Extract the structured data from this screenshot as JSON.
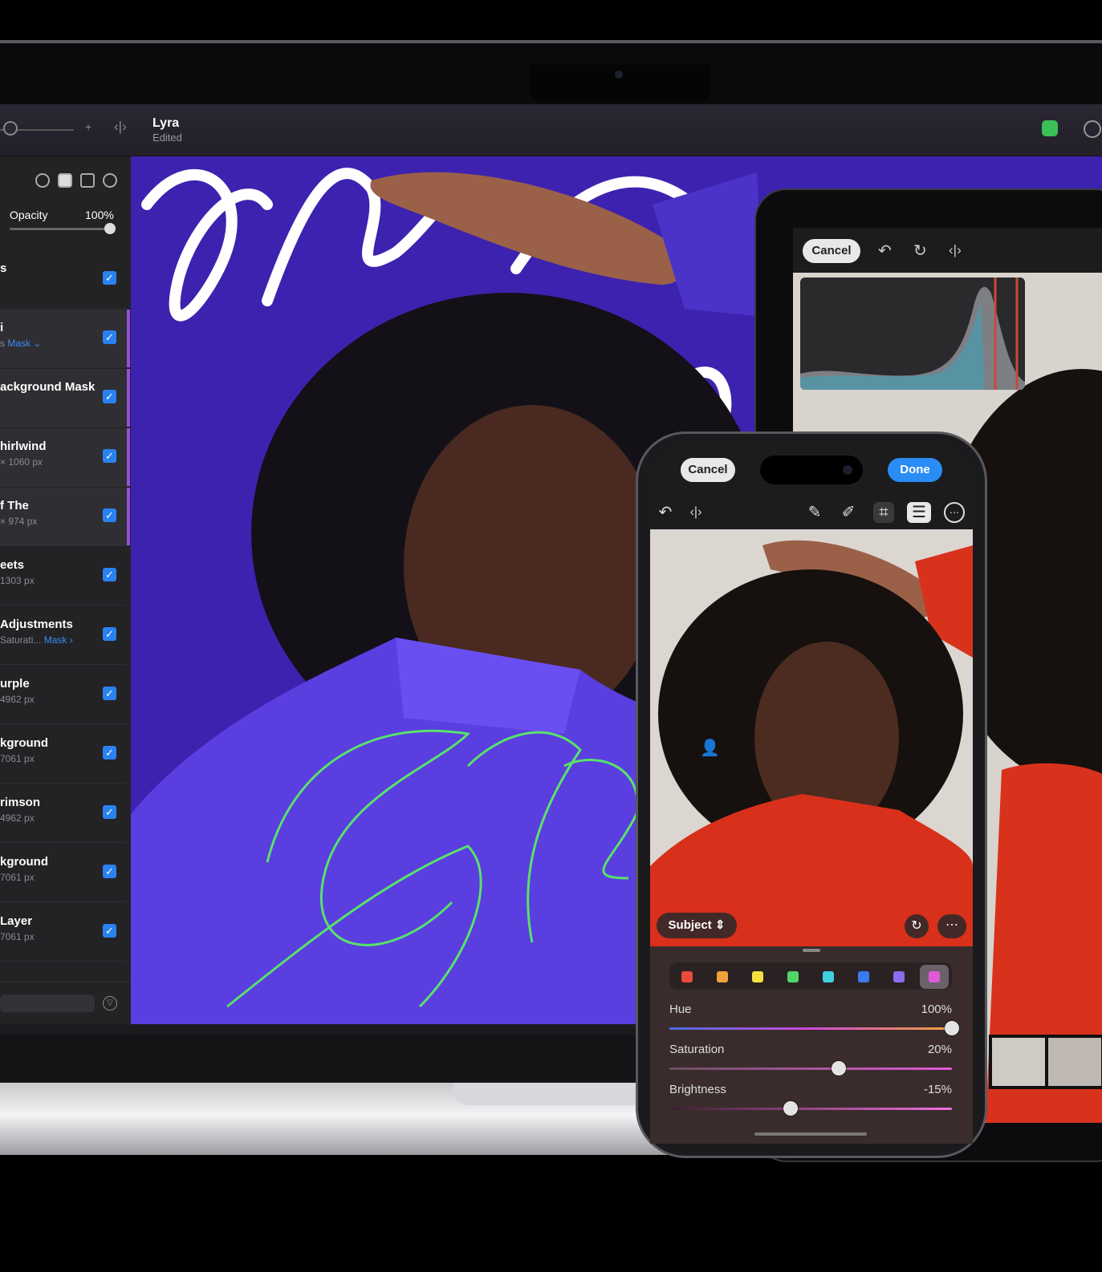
{
  "mac": {
    "document": {
      "title": "Lyra",
      "status": "Edited"
    },
    "sidebar": {
      "opacity_label": "Opacity",
      "opacity_value": "100%",
      "layers": [
        {
          "name": "s",
          "sub": "",
          "mask": "",
          "checked": true,
          "selected": false
        },
        {
          "name": "i",
          "sub": "s",
          "mask": "Mask ⌄",
          "checked": true,
          "selected": true
        },
        {
          "name": "ackground Mask",
          "sub": "",
          "mask": "",
          "checked": true,
          "selected": true
        },
        {
          "name": "hirlwind",
          "sub": "× 1060 px",
          "mask": "",
          "checked": true,
          "selected": true
        },
        {
          "name": "f The",
          "sub": "× 974 px",
          "mask": "",
          "checked": true,
          "selected": true
        },
        {
          "name": "eets",
          "sub": "1303 px",
          "mask": "",
          "checked": true,
          "selected": false
        },
        {
          "name": "Adjustments",
          "sub": "Saturati...",
          "mask": "Mask ›",
          "checked": true,
          "selected": false
        },
        {
          "name": "urple",
          "sub": "4962 px",
          "mask": "",
          "checked": true,
          "selected": false
        },
        {
          "name": "kground",
          "sub": "7061 px",
          "mask": "",
          "checked": true,
          "selected": false
        },
        {
          "name": "rimson",
          "sub": "4962 px",
          "mask": "",
          "checked": true,
          "selected": false
        },
        {
          "name": "kground",
          "sub": "7061 px",
          "mask": "",
          "checked": true,
          "selected": false
        },
        {
          "name": "Layer",
          "sub": "7061 px",
          "mask": "",
          "checked": true,
          "selected": false
        }
      ]
    },
    "canvas_colors": {
      "background": "#3d22b0",
      "sweater": "#5a3ee0",
      "lettering_white": "#ffffff",
      "lettering_green": "#57e36a"
    }
  },
  "ipad": {
    "cancel_label": "Cancel",
    "toolbar_icons": [
      "undo-icon",
      "revert-icon",
      "compare-icon"
    ]
  },
  "iphone": {
    "cancel_label": "Cancel",
    "done_label": "Done",
    "toolbar_icons": [
      "undo-icon",
      "compare-icon",
      "magic-wand-icon",
      "retouch-icon",
      "crop-icon",
      "adjustments-icon",
      "more-icon"
    ],
    "subject_label": "Subject",
    "swatches": [
      "#e94a3a",
      "#f2a23a",
      "#f5e042",
      "#52d66a",
      "#3fd0e0",
      "#3a7bf0",
      "#8a6cf0",
      "#e05ad8"
    ],
    "selected_swatch": 7,
    "adjustments": [
      {
        "label": "Hue",
        "value": "100%",
        "level": 1.0
      },
      {
        "label": "Saturation",
        "value": "20%",
        "level": 0.6
      },
      {
        "label": "Brightness",
        "value": "-15%",
        "level": 0.43
      }
    ],
    "accent": "#2a8cf5"
  }
}
